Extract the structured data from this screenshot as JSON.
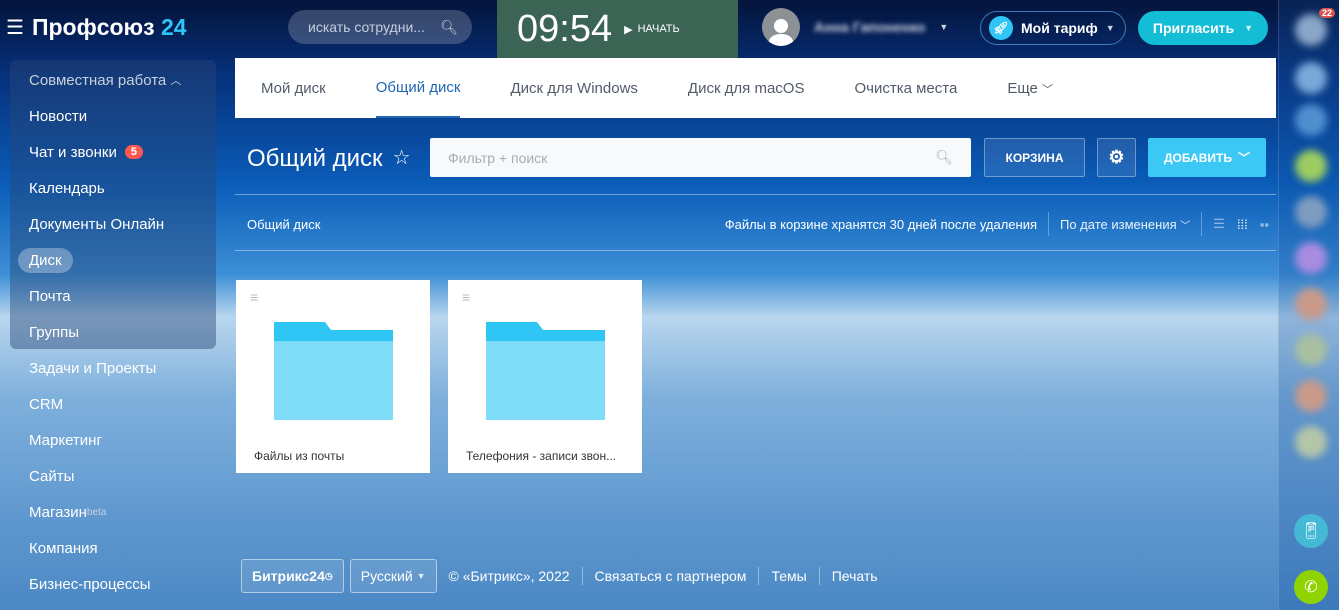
{
  "header": {
    "brand": "Профсоюз",
    "brand_num": "24",
    "search_placeholder": "искать сотрудни...",
    "time": "09:54",
    "start_label": "НАЧАТЬ",
    "user_name": "Анна Гапоненко",
    "tariff_label": "Мой тариф",
    "invite_label": "Пригласить"
  },
  "sidebar": {
    "group": "Совместная работа",
    "items": [
      {
        "label": "Новости"
      },
      {
        "label": "Чат и звонки",
        "badge": "5"
      },
      {
        "label": "Календарь"
      },
      {
        "label": "Документы Онлайн"
      },
      {
        "label": "Диск",
        "active": true
      },
      {
        "label": "Почта"
      },
      {
        "label": "Группы"
      },
      {
        "label": "Задачи и Проекты"
      },
      {
        "label": "CRM"
      },
      {
        "label": "Маркетинг"
      },
      {
        "label": "Сайты"
      },
      {
        "label": "Магазин",
        "sup": "beta"
      },
      {
        "label": "Компания"
      },
      {
        "label": "Бизнес-процессы"
      }
    ]
  },
  "tabs": [
    "Мой диск",
    "Общий диск",
    "Диск для Windows",
    "Диск для macOS",
    "Очистка места",
    "Еще"
  ],
  "page": {
    "title": "Общий диск",
    "filter_placeholder": "Фильтр + поиск",
    "trash_label": "КОРЗИНА",
    "add_label": "ДОБАВИТЬ",
    "breadcrumb": "Общий диск",
    "trash_note": "Файлы в корзине хранятся 30 дней после удаления",
    "sort_label": "По дате изменения"
  },
  "folders": [
    {
      "name": "Файлы из почты"
    },
    {
      "name": "Телефония - записи звон..."
    }
  ],
  "footer": {
    "brand": "Битрикс24",
    "language": "Русский",
    "copyright": "© «Битрикс», 2022",
    "partner": "Связаться с партнером",
    "themes": "Темы",
    "print": "Печать"
  },
  "right_panel": {
    "notifications_count": "22"
  }
}
